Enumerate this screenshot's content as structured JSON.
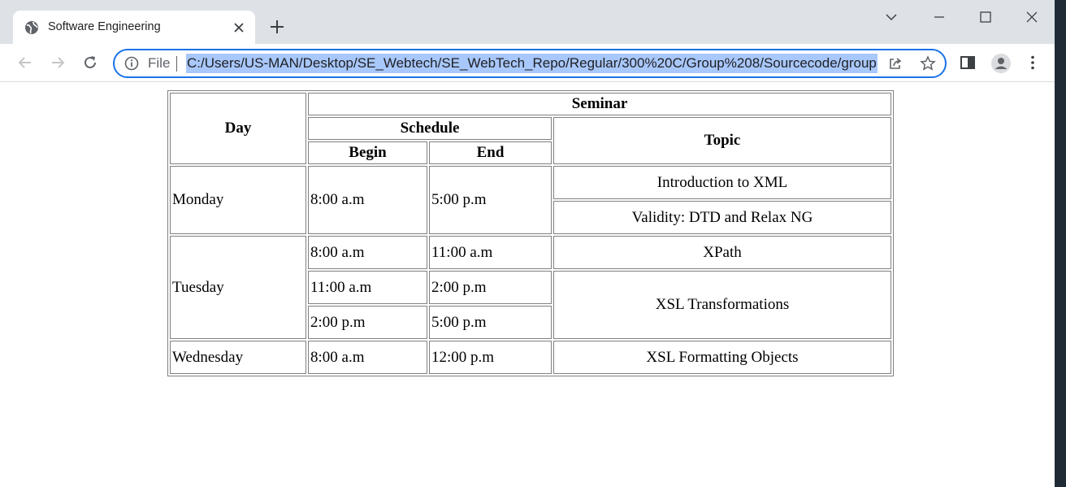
{
  "browser": {
    "tab_title": "Software Engineering",
    "scheme_label": "File",
    "url": "C:/Users/US-MAN/Desktop/SE_Webtech/SE_WebTech_Repo/Regular/300%20C/Group%208/Sourcecode/group"
  },
  "table": {
    "header_seminar": "Seminar",
    "header_day": "Day",
    "header_schedule": "Schedule",
    "header_topic": "Topic",
    "header_begin": "Begin",
    "header_end": "End",
    "monday": {
      "day": "Monday",
      "begin": "8:00 a.m",
      "end": "5:00 p.m",
      "topic1": "Introduction to XML",
      "topic2": "Validity: DTD and Relax NG"
    },
    "tuesday": {
      "day": "Tuesday",
      "rows": [
        {
          "begin": "8:00 a.m",
          "end": "11:00 a.m"
        },
        {
          "begin": "11:00 a.m",
          "end": "2:00 p.m"
        },
        {
          "begin": "2:00 p.m",
          "end": "5:00 p.m"
        }
      ],
      "topic1": "XPath",
      "topic2": "XSL Transformations"
    },
    "wednesday": {
      "day": "Wednesday",
      "begin": "8:00 a.m",
      "end": "12:00 p.m",
      "topic": "XSL Formatting Objects"
    }
  },
  "colors": {
    "accent": "#1a73e8",
    "selection": "#a8c7fa",
    "tabstrip": "#dee1e6"
  }
}
